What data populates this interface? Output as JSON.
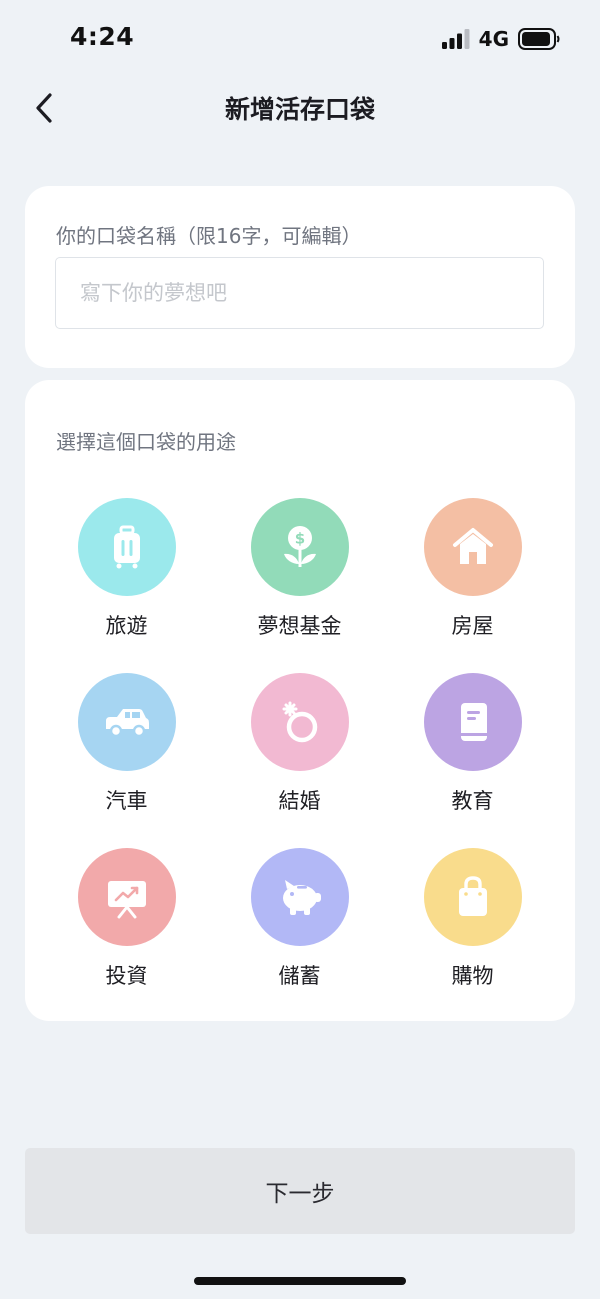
{
  "status_bar": {
    "time": "4:24",
    "network": "4G"
  },
  "nav": {
    "title": "新增活存口袋"
  },
  "name_card": {
    "label": "你的口袋名稱（限16字，可編輯）",
    "input_value": "",
    "placeholder": "寫下你的夢想吧"
  },
  "purpose_card": {
    "label": "選擇這個口袋的用途",
    "items": [
      {
        "label": "旅遊",
        "icon": "suitcase-icon",
        "color": "#9be9ec"
      },
      {
        "label": "夢想基金",
        "icon": "money-plant-icon",
        "color": "#92dbb9"
      },
      {
        "label": "房屋",
        "icon": "house-icon",
        "color": "#f4bfa4"
      },
      {
        "label": "汽車",
        "icon": "car-icon",
        "color": "#a6d5f2"
      },
      {
        "label": "結婚",
        "icon": "ring-icon",
        "color": "#f2b9d2"
      },
      {
        "label": "教育",
        "icon": "book-icon",
        "color": "#bca4e3"
      },
      {
        "label": "投資",
        "icon": "chart-board-icon",
        "color": "#f2a9aa"
      },
      {
        "label": "儲蓄",
        "icon": "piggy-bank-icon",
        "color": "#b2b8f6"
      },
      {
        "label": "購物",
        "icon": "shopping-bag-icon",
        "color": "#f9dc8c"
      }
    ]
  },
  "footer": {
    "next_label": "下一步"
  }
}
